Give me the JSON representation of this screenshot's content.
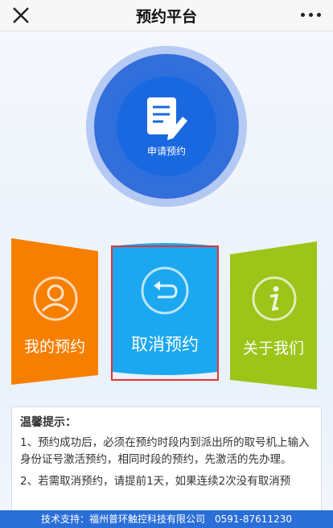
{
  "header": {
    "title": "预约平台",
    "close_icon": "close-icon",
    "more_icon": "more-icon"
  },
  "main_action": {
    "label": "申请预约",
    "icon": "document-edit-icon"
  },
  "cards": [
    {
      "label": "我的预约",
      "icon": "user-icon",
      "color": "#f77f00"
    },
    {
      "label": "取消预约",
      "icon": "undo-arrow-icon",
      "color": "#1ba8f0"
    },
    {
      "label": "关于我们",
      "icon": "info-icon",
      "color": "#9cc419"
    }
  ],
  "notice": {
    "title": "温馨提示：",
    "items": [
      "1、预约成功后，必须在预约时段内到派出所的取号机上输入身份证号激活预约，相同时段的预约，先激活的先办理。",
      "2、若需取消预约，请提前1天，如果连续2次没有取消预"
    ]
  },
  "footer": {
    "text": "技术支持：福州普环触控科技有限公司　0591-87611230"
  },
  "colors": {
    "blue": "#1a68e0",
    "highlight": "#e2343a",
    "footer": "#2a6ed8"
  }
}
